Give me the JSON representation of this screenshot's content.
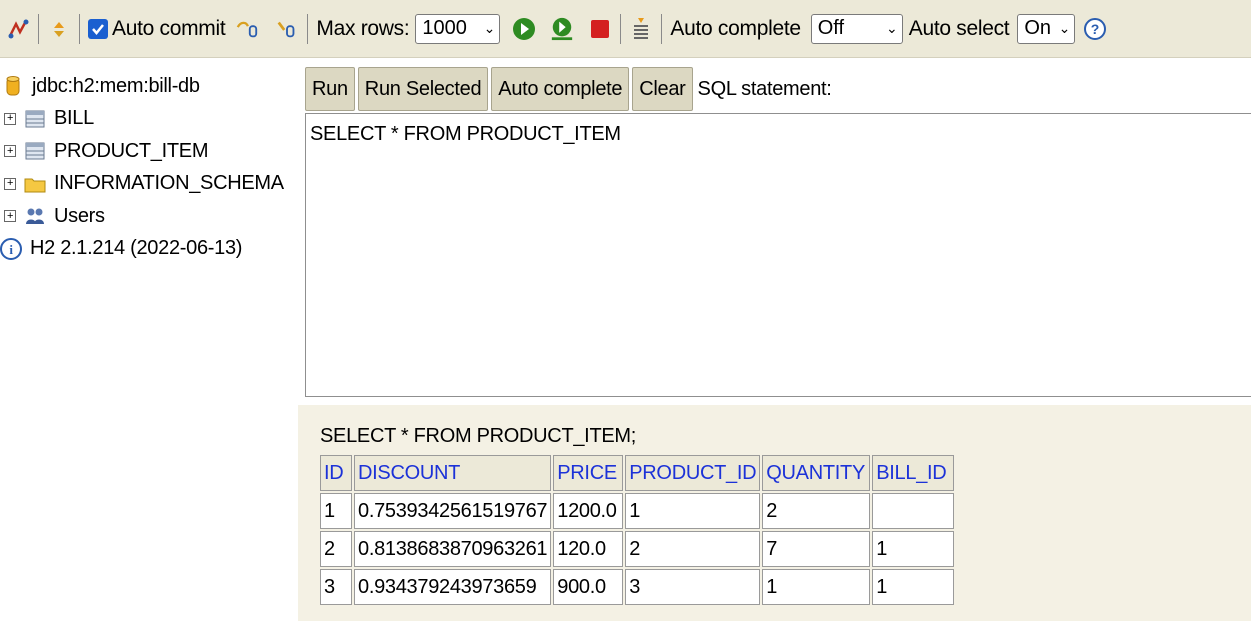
{
  "toolbar": {
    "auto_commit_label": "Auto commit",
    "max_rows_label": "Max rows:",
    "max_rows_value": "1000",
    "auto_complete_label": "Auto complete",
    "auto_complete_value": "Off",
    "auto_select_label": "Auto select",
    "auto_select_value": "On"
  },
  "tree": {
    "connection": "jdbc:h2:mem:bill-db",
    "items": [
      {
        "label": "BILL",
        "icon": "table-icon"
      },
      {
        "label": "PRODUCT_ITEM",
        "icon": "table-icon"
      },
      {
        "label": "INFORMATION_SCHEMA",
        "icon": "folder-icon"
      },
      {
        "label": "Users",
        "icon": "users-icon"
      }
    ],
    "version": "H2 2.1.214 (2022-06-13)"
  },
  "buttons": {
    "run": "Run",
    "run_selected": "Run Selected",
    "auto_complete": "Auto complete",
    "clear": "Clear",
    "sql_statement_label": "SQL statement:"
  },
  "editor": {
    "text": "SELECT * FROM PRODUCT_ITEM"
  },
  "results": {
    "query": "SELECT * FROM PRODUCT_ITEM;",
    "columns": [
      "ID",
      "DISCOUNT",
      "PRICE",
      "PRODUCT_ID",
      "QUANTITY",
      "BILL_ID"
    ],
    "rows": [
      [
        "1",
        "0.7539342561519767",
        "1200.0",
        "1",
        "2",
        ""
      ],
      [
        "2",
        "0.8138683870963261",
        "120.0",
        "2",
        "7",
        "1"
      ],
      [
        "3",
        "0.934379243973659",
        "900.0",
        "3",
        "1",
        "1"
      ]
    ]
  },
  "colors": {
    "toolbar_bg": "#ece9d8",
    "header_text": "#1c32d8",
    "checkbox": "#1a5fd0",
    "run_green": "#2e8b22",
    "stop_red": "#d42020"
  }
}
